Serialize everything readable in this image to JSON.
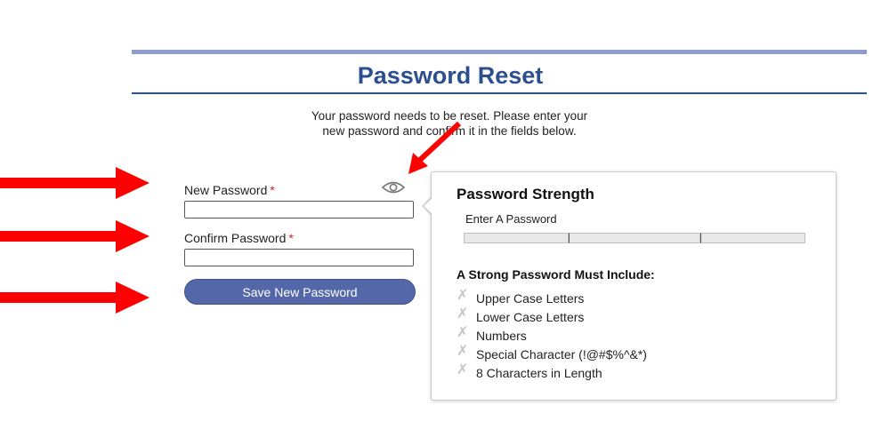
{
  "page": {
    "title": "Password Reset",
    "intro_line1": "Your password needs to be reset. Please enter your",
    "intro_line2": "new password and confirm it in the fields below."
  },
  "form": {
    "new_password": {
      "label": "New Password",
      "required_mark": "*",
      "value": "",
      "placeholder": ""
    },
    "confirm_password": {
      "label": "Confirm Password",
      "required_mark": "*",
      "value": "",
      "placeholder": ""
    },
    "toggle_visibility_icon": "eye-icon",
    "save_label": "Save New Password"
  },
  "strength_panel": {
    "title": "Password Strength",
    "status": "Enter A Password",
    "meter_segments": 3,
    "meter_fill": 0,
    "requirements_title": "A Strong Password Must Include:",
    "requirements": [
      {
        "label": "Upper Case Letters",
        "met": false
      },
      {
        "label": "Lower Case Letters",
        "met": false
      },
      {
        "label": "Numbers",
        "met": false
      },
      {
        "label": "Special Character (!@#$%^&*)",
        "met": false
      },
      {
        "label": "8 Characters in Length",
        "met": false
      }
    ],
    "unmet_icon": "x-mark-icon"
  },
  "colors": {
    "heading": "#2e4f8f",
    "top_rule": "#8f9cd0",
    "button": "#5467a8",
    "required": "#c0282d",
    "annotation_arrow": "#ff0000",
    "unmet_icon": "#c4c4c4"
  }
}
